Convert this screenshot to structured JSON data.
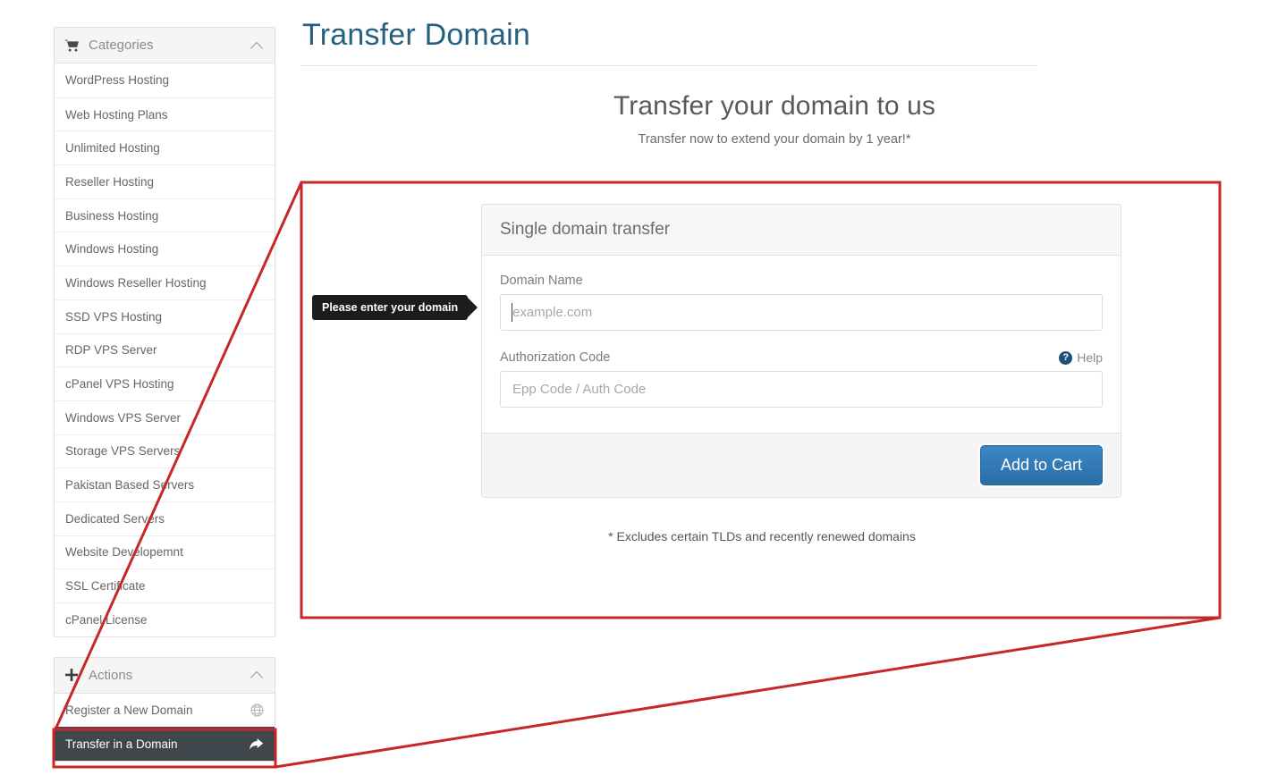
{
  "sidebar": {
    "categories": {
      "title": "Categories",
      "icon": "shopping-cart-icon",
      "collapse_icon": "chevron-up-icon",
      "items": [
        {
          "label": "WordPress Hosting"
        },
        {
          "label": "Web Hosting Plans"
        },
        {
          "label": "Unlimited Hosting"
        },
        {
          "label": "Reseller Hosting"
        },
        {
          "label": "Business Hosting"
        },
        {
          "label": "Windows Hosting"
        },
        {
          "label": "Windows Reseller Hosting"
        },
        {
          "label": "SSD VPS Hosting"
        },
        {
          "label": "RDP VPS Server"
        },
        {
          "label": "cPanel VPS Hosting"
        },
        {
          "label": "Windows VPS Server"
        },
        {
          "label": "Storage VPS Servers"
        },
        {
          "label": "Pakistan Based Servers"
        },
        {
          "label": "Dedicated Servers"
        },
        {
          "label": "Website Developemnt"
        },
        {
          "label": "SSL Certificate"
        },
        {
          "label": "cPanel License"
        }
      ]
    },
    "actions": {
      "title": "Actions",
      "icon": "plus-icon",
      "collapse_icon": "chevron-up-icon",
      "items": [
        {
          "label": "Register a New Domain",
          "icon": "globe-icon",
          "active": false
        },
        {
          "label": "Transfer in a Domain",
          "icon": "share-arrow-icon",
          "active": true
        }
      ]
    }
  },
  "main": {
    "page_title": "Transfer Domain",
    "hero_title": "Transfer your domain to us",
    "hero_subtitle": "Transfer now to extend your domain by 1 year!*",
    "footnote": "* Excludes certain TLDs and recently renewed domains"
  },
  "card": {
    "header": "Single domain transfer",
    "domain": {
      "label": "Domain Name",
      "placeholder": "example.com",
      "value": ""
    },
    "auth": {
      "label": "Authorization Code",
      "placeholder": "Epp Code / Auth Code",
      "value": "",
      "help_label": "Help",
      "help_icon": "question-circle-icon"
    },
    "submit_label": "Add to Cart"
  },
  "tooltip": {
    "text": "Please enter your domain"
  },
  "colors": {
    "page_title": "#26607e",
    "button_blue": "#2b6ea8",
    "annotation_red": "#c62828",
    "active_item_bg": "#3f474c",
    "help_icon_blue": "#1c4f80"
  }
}
